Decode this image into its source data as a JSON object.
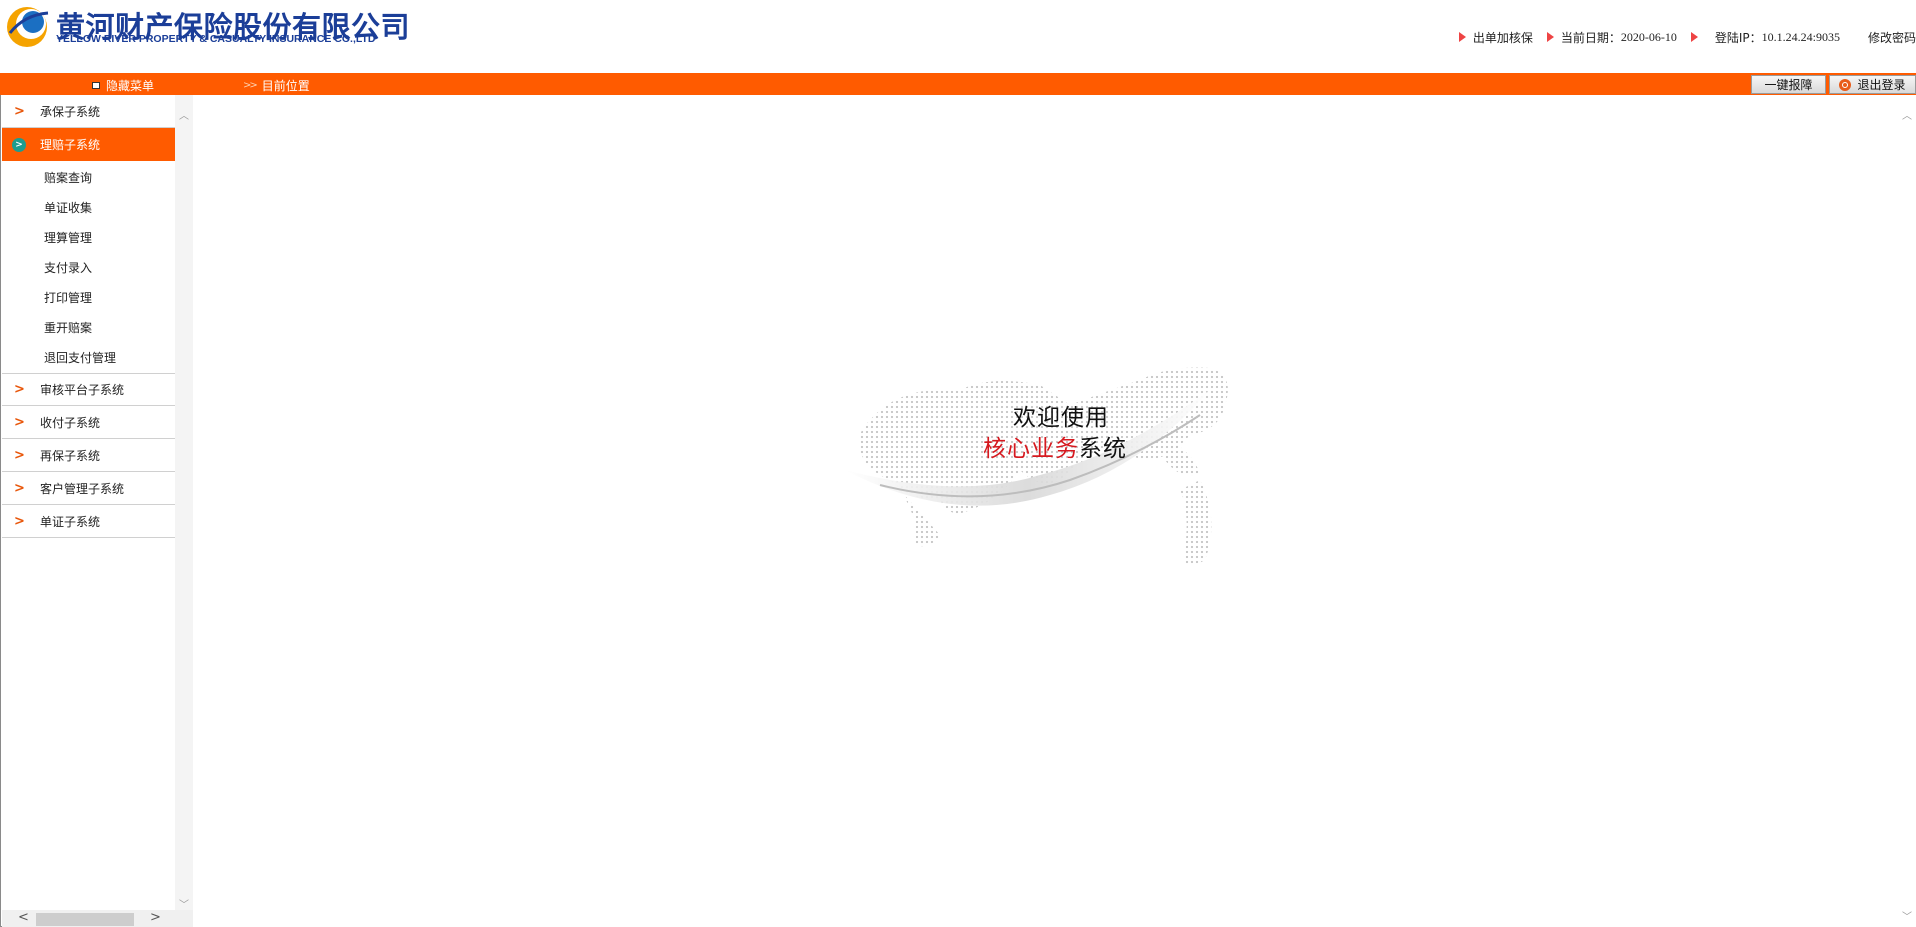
{
  "header": {
    "company_cn": "黄河财产保险股份有限公司",
    "company_en": "YELLOW RIVER PROPERTY & CASUALTY INSURANCE CO.,LTD",
    "link_add_verify": "出单加核保",
    "date_label": "当前日期：",
    "date_value": "2020-06-10",
    "ip_label": "登陆IP：",
    "ip_value": "10.1.24.24:9035",
    "change_password": "修改密码"
  },
  "toolbar": {
    "hide_menu": "隐藏菜单",
    "location_arrow": ">>",
    "location": "目前位置",
    "report_fault": "一键报障",
    "logout": "退出登录"
  },
  "sidebar": {
    "items": [
      {
        "label": "承保子系统",
        "active": false
      },
      {
        "label": "理赔子系统",
        "active": true
      },
      {
        "label": "审核平台子系统",
        "active": false
      },
      {
        "label": "收付子系统",
        "active": false
      },
      {
        "label": "再保子系统",
        "active": false
      },
      {
        "label": "客户管理子系统",
        "active": false
      },
      {
        "label": "单证子系统",
        "active": false
      }
    ],
    "sub_items": [
      "赔案查询",
      "单证收集",
      "理算管理",
      "支付录入",
      "打印管理",
      "重开赔案",
      "退回支付管理"
    ]
  },
  "main": {
    "welcome_line1": "欢迎使用",
    "welcome_red": "核心业务",
    "welcome_rest": "系统"
  },
  "colors": {
    "accent_orange": "#ff5b00",
    "logo_blue": "#1b3e98",
    "welcome_red": "#d6191f"
  }
}
